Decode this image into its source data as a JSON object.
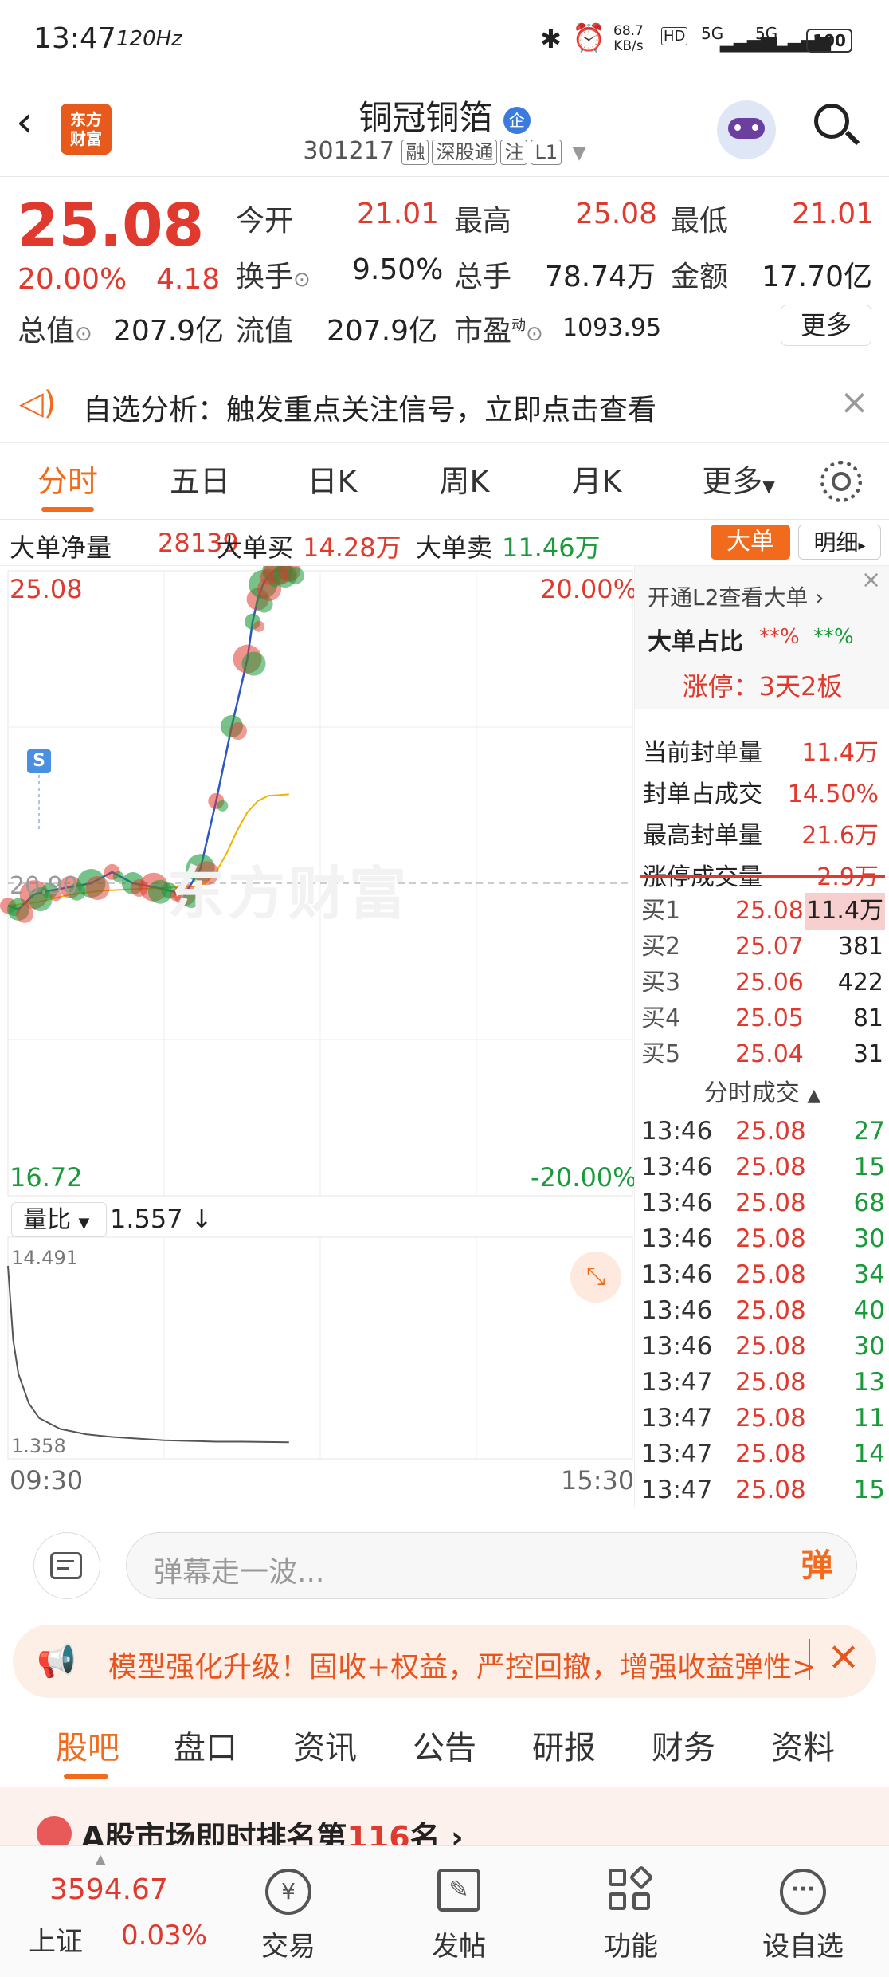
{
  "status": {
    "time": "13:47",
    "refresh": "120Hz",
    "netspeed": "68.7",
    "netunit": "KB/s",
    "signal1": "5G",
    "signal2": "5G",
    "battery": "100"
  },
  "header": {
    "title": "铜冠铜箔",
    "badge": "企",
    "code": "301217",
    "tags": [
      "融",
      "深股通",
      "注",
      "L1"
    ],
    "logo_line1": "东方",
    "logo_line2": "财富"
  },
  "quote": {
    "price": "25.08",
    "pct": "20.00%",
    "change": "4.18",
    "open_label": "今开",
    "open": "21.01",
    "high_label": "最高",
    "high": "25.08",
    "low_label": "最低",
    "low": "21.01",
    "turnover_label": "换手",
    "turnover": "9.50%",
    "volume_label": "总手",
    "volume": "78.74万",
    "amount_label": "金额",
    "amount": "17.70亿",
    "mktcap_label": "总值",
    "mktcap": "207.9亿",
    "float_label": "流值",
    "float": "207.9亿",
    "pe_label": "市盈",
    "pe_sup": "动",
    "pe": "1093.95",
    "more": "更多"
  },
  "notice": {
    "text": "自选分析：触发重点关注信号，立即点击查看"
  },
  "tabs": [
    "分时",
    "五日",
    "日K",
    "周K",
    "月K",
    "更多"
  ],
  "bigorder": {
    "net_label": "大单净量",
    "net": "28139",
    "buy_label": "大单买",
    "buy": "14.28万",
    "sell_label": "大单卖",
    "sell": "11.46万",
    "btn_big": "大单",
    "btn_detail": "明细"
  },
  "chart": {
    "high": "25.08",
    "high_pct": "20.00%",
    "low": "16.72",
    "low_pct": "-20.00%",
    "prev_close": "20.90",
    "watermark": "东方财富",
    "marker": "S",
    "vol_ratio_label": "量比",
    "vol_ratio": "1.557",
    "vr_top": "14.491",
    "vr_bottom": "1.358",
    "time_start": "09:30",
    "time_end": "15:30"
  },
  "chart_data": {
    "type": "line",
    "title": "",
    "ylim": [
      16.72,
      25.08
    ],
    "prev_close": 20.9,
    "series": [
      {
        "x": [
          0,
          2,
          5,
          8,
          12,
          16,
          20,
          24,
          28,
          31,
          34,
          37,
          40,
          43,
          46,
          47,
          48,
          49,
          50,
          51,
          52,
          53,
          54
        ],
        "values": [
          20.6,
          20.55,
          20.75,
          20.8,
          20.85,
          20.9,
          21.05,
          20.9,
          20.85,
          20.8,
          20.75,
          21.1,
          22.0,
          23.0,
          23.9,
          24.4,
          24.7,
          24.9,
          25.0,
          25.08,
          25.08,
          25.08,
          25.08
        ]
      },
      {
        "x": [
          0,
          6,
          12,
          18,
          24,
          30,
          36,
          38,
          40,
          42,
          44,
          46,
          48,
          50,
          52,
          54
        ],
        "values": [
          20.6,
          20.65,
          20.75,
          20.8,
          20.82,
          20.84,
          20.86,
          20.9,
          21.05,
          21.3,
          21.6,
          21.85,
          22.0,
          22.07,
          22.08,
          22.09
        ]
      }
    ],
    "vol_ratio": {
      "x": [
        0,
        1,
        2,
        4,
        6,
        10,
        15,
        20,
        30,
        40,
        45,
        54
      ],
      "values": [
        14.491,
        9.0,
        6.5,
        4.3,
        3.2,
        2.4,
        2.0,
        1.8,
        1.55,
        1.45,
        1.45,
        1.4
      ]
    }
  },
  "l2": {
    "open_l2": "开通L2查看大单",
    "ratio_label": "大单占比",
    "ratio_buy": "**%",
    "ratio_sell": "**%",
    "limit_label": "涨停：3天2板",
    "rows": [
      {
        "label": "当前封单量",
        "value": "11.4万"
      },
      {
        "label": "封单占成交",
        "value": "14.50%"
      },
      {
        "label": "最高封单量",
        "value": "21.6万"
      },
      {
        "label": "涨停成交量",
        "value": "2.9万"
      }
    ]
  },
  "bids": [
    {
      "label": "买1",
      "price": "25.08",
      "vol": "11.4万"
    },
    {
      "label": "买2",
      "price": "25.07",
      "vol": "381"
    },
    {
      "label": "买3",
      "price": "25.06",
      "vol": "422"
    },
    {
      "label": "买4",
      "price": "25.05",
      "vol": "81"
    },
    {
      "label": "买5",
      "price": "25.04",
      "vol": "31"
    }
  ],
  "ticks_title": "分时成交",
  "ticks": [
    {
      "time": "13:46",
      "price": "25.08",
      "vol": "27"
    },
    {
      "time": "13:46",
      "price": "25.08",
      "vol": "15"
    },
    {
      "time": "13:46",
      "price": "25.08",
      "vol": "68"
    },
    {
      "time": "13:46",
      "price": "25.08",
      "vol": "30"
    },
    {
      "time": "13:46",
      "price": "25.08",
      "vol": "34"
    },
    {
      "time": "13:46",
      "price": "25.08",
      "vol": "40"
    },
    {
      "time": "13:46",
      "price": "25.08",
      "vol": "30"
    },
    {
      "time": "13:47",
      "price": "25.08",
      "vol": "13"
    },
    {
      "time": "13:47",
      "price": "25.08",
      "vol": "11"
    },
    {
      "time": "13:47",
      "price": "25.08",
      "vol": "14"
    },
    {
      "time": "13:47",
      "price": "25.08",
      "vol": "15"
    }
  ],
  "danmu": {
    "placeholder": "弹幕走一波...",
    "btn": "弹"
  },
  "ad": {
    "text": "模型强化升级！固收+权益，严控回撤，增强收益弹性>"
  },
  "bottom_tabs": [
    "股吧",
    "盘口",
    "资讯",
    "公告",
    "研报",
    "财务",
    "资料"
  ],
  "rank": {
    "prefix": "A股市场即时排名第",
    "num": "116",
    "suffix": "名"
  },
  "index": {
    "value": "3594.67",
    "name": "上证",
    "pct": "0.03%"
  },
  "nav": [
    "交易",
    "发帖",
    "功能",
    "设自选"
  ],
  "colors": {
    "up": "#e03a2f",
    "down": "#1a9a3a",
    "accent": "#f26b1d",
    "price_line": "#2a56c6",
    "avg_line": "#f0b400"
  }
}
